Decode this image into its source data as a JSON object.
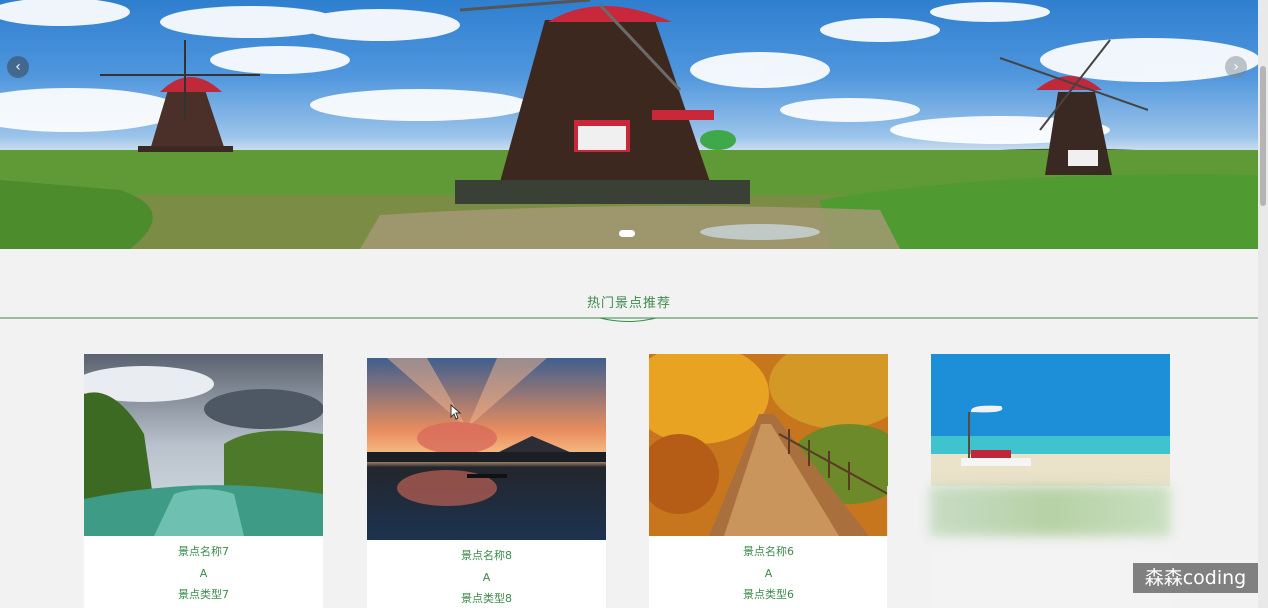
{
  "carousel": {
    "prev_icon": "‹",
    "next_icon": "›",
    "slide_count": 1,
    "active_slide": 1
  },
  "section": {
    "title": "热门景点推荐"
  },
  "cards": [
    {
      "name": "景点名称7",
      "rating": "A",
      "type": "景点类型7",
      "image": "river-forest-landscape"
    },
    {
      "name": "景点名称8",
      "rating": "A",
      "type": "景点类型8",
      "image": "sunset-lake-mountain"
    },
    {
      "name": "景点名称6",
      "rating": "A",
      "type": "景点类型6",
      "image": "autumn-forest-path"
    },
    {
      "name": "",
      "rating": "",
      "type": "",
      "image": "tropical-beach-umbrella"
    }
  ],
  "watermark": "森森coding",
  "colors": {
    "accent_green": "#3d8b4d",
    "background": "#f2f2f2"
  }
}
